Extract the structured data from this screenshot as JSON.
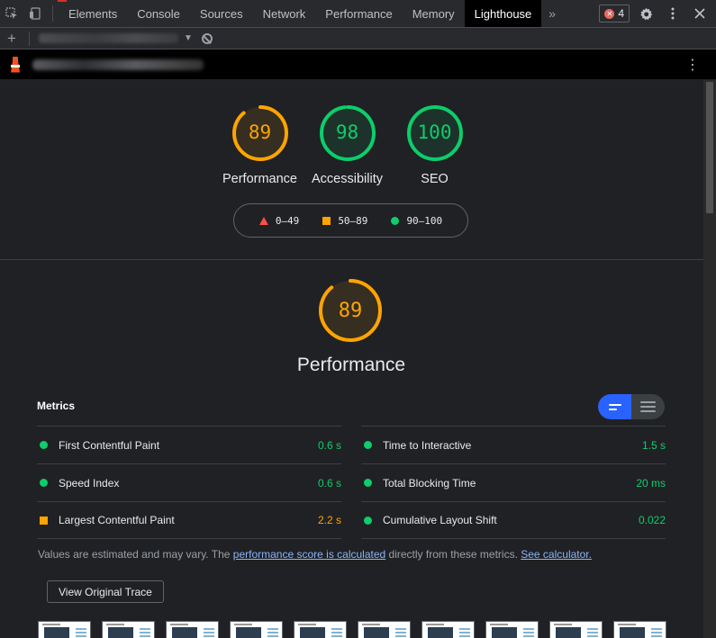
{
  "devtools": {
    "tabs": [
      {
        "label": "Elements",
        "active": false
      },
      {
        "label": "Console",
        "active": false
      },
      {
        "label": "Sources",
        "active": false
      },
      {
        "label": "Network",
        "active": false
      },
      {
        "label": "Performance",
        "active": false
      },
      {
        "label": "Memory",
        "active": false
      },
      {
        "label": "Lighthouse",
        "active": true
      }
    ],
    "more_tabs_glyph": "»",
    "error_count": "4",
    "icons": [
      "inspect-element-icon",
      "device-toolbar-icon",
      "settings-gear-icon",
      "kebab-menu-icon",
      "close-icon"
    ]
  },
  "lighthouse_bar": {
    "add_glyph": "+",
    "report_selector_blurred": true
  },
  "url_bar": {
    "url_blurred": true,
    "menu_glyph": "⋮"
  },
  "summary_gauges": [
    {
      "score": "89",
      "label": "Performance",
      "score_fraction": 0.89,
      "color": "#ffa400"
    },
    {
      "score": "98",
      "label": "Accessibility",
      "score_fraction": 0.98,
      "color": "#0cce6b"
    },
    {
      "score": "100",
      "label": "SEO",
      "score_fraction": 1.0,
      "color": "#0cce6b"
    }
  ],
  "legend": {
    "fail": "0–49",
    "average": "50–89",
    "pass": "90–100"
  },
  "performance": {
    "score": "89",
    "score_fraction": 0.89,
    "title": "Performance",
    "color": "#ffa400"
  },
  "metrics": {
    "heading": "Metrics",
    "left": [
      {
        "name": "First Contentful Paint",
        "value": "0.6 s",
        "status": "pass"
      },
      {
        "name": "Speed Index",
        "value": "0.6 s",
        "status": "pass"
      },
      {
        "name": "Largest Contentful Paint",
        "value": "2.2 s",
        "status": "average"
      }
    ],
    "right": [
      {
        "name": "Time to Interactive",
        "value": "1.5 s",
        "status": "pass"
      },
      {
        "name": "Total Blocking Time",
        "value": "20 ms",
        "status": "pass"
      },
      {
        "name": "Cumulative Layout Shift",
        "value": "0.022",
        "status": "pass"
      }
    ]
  },
  "note": {
    "prefix": "Values are estimated and may vary. The ",
    "link1": "performance score is calculated",
    "middle": " directly from these metrics. ",
    "link2": "See calculator."
  },
  "trace_button": "View Original Trace",
  "colors": {
    "pass": "#0cce6b",
    "average": "#ffa400",
    "fail": "#ff4e42",
    "accent": "#2962ff"
  }
}
